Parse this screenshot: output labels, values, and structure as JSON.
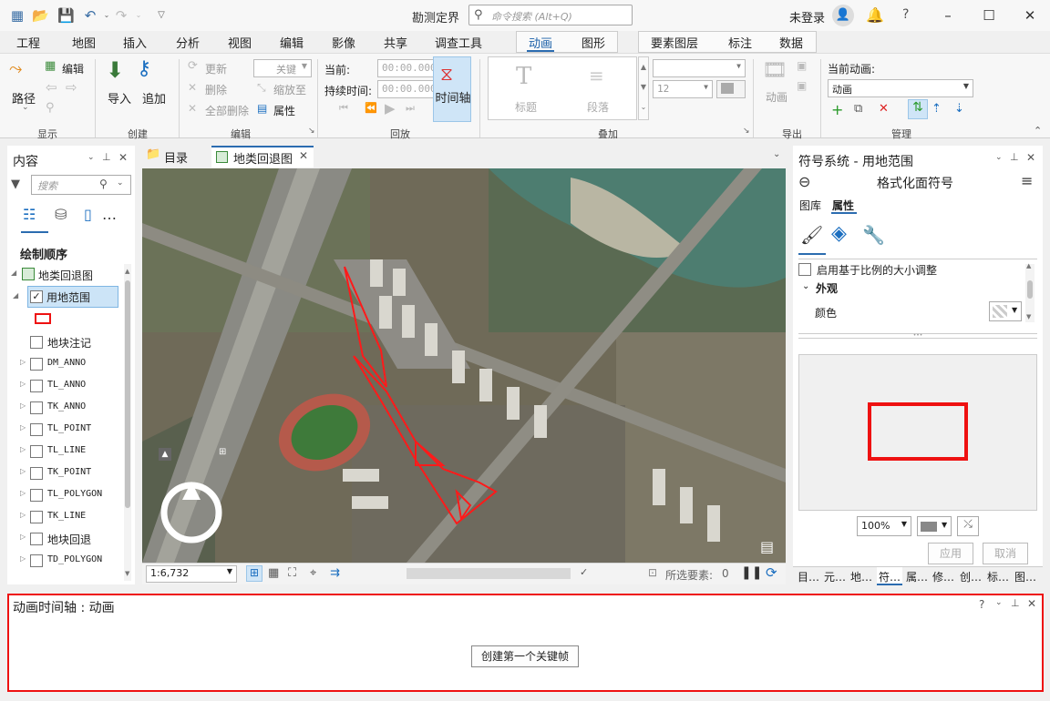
{
  "titlebar": {
    "title": "勘测定界",
    "search_placeholder": "命令搜索 (Alt+Q)",
    "login": "未登录"
  },
  "tabs": [
    "工程",
    "地图",
    "插入",
    "分析",
    "视图",
    "编辑",
    "影像",
    "共享",
    "调查工具",
    "动画",
    "图形",
    "要素图层",
    "标注",
    "数据"
  ],
  "ribbon": {
    "display": {
      "path": "路径",
      "edit": "编辑",
      "group": "显示"
    },
    "create": {
      "import": "导入",
      "add": "追加",
      "group": "创建"
    },
    "edit": {
      "update": "更新",
      "delete": "删除",
      "delete_all": "全部删除",
      "keyframe": "关键",
      "zoom_to": "缩放至",
      "properties": "属性",
      "group": "编辑"
    },
    "playback": {
      "current": "当前:",
      "duration": "持续时间:",
      "current_val": "00:00.000",
      "duration_val": "00:00.000",
      "timeline": "时间轴",
      "group": "回放"
    },
    "overlay": {
      "title": "标题",
      "paragraph": "段落",
      "font_size": "12",
      "group": "叠加"
    },
    "export": {
      "animation": "动画",
      "group": "导出"
    },
    "manage": {
      "current_anim_label": "当前动画:",
      "current_anim": "动画",
      "group": "管理"
    }
  },
  "contents": {
    "title": "内容",
    "search_placeholder": "搜索",
    "draw_order": "绘制顺序",
    "map_name": "地类回退图",
    "layers": [
      {
        "name": "用地范围",
        "checked": true
      },
      {
        "name": "地块注记",
        "checked": false
      },
      {
        "name": "DM_ANNO",
        "checked": false
      },
      {
        "name": "TL_ANNO",
        "checked": false
      },
      {
        "name": "TK_ANNO",
        "checked": false
      },
      {
        "name": "TL_POINT",
        "checked": false
      },
      {
        "name": "TL_LINE",
        "checked": false
      },
      {
        "name": "TK_POINT",
        "checked": false
      },
      {
        "name": "TL_POLYGON",
        "checked": false
      },
      {
        "name": "TK_LINE",
        "checked": false
      },
      {
        "name": "地块回退",
        "checked": false
      },
      {
        "name": "TD_POLYGON",
        "checked": false
      }
    ]
  },
  "view_tabs": {
    "catalog": "目录",
    "map": "地类回退图"
  },
  "statusbar": {
    "scale": "1:6,732",
    "selected": "所选要素:",
    "selected_count": "0"
  },
  "symbology": {
    "title": "符号系统 - 用地范围",
    "subtitle": "格式化面符号",
    "tab_gallery": "图库",
    "tab_properties": "属性",
    "scale_option": "启用基于比例的大小调整",
    "appearance": "外观",
    "color": "颜色",
    "zoom": "100%",
    "apply": "应用",
    "cancel": "取消",
    "bottom_tabs": [
      "目…",
      "元…",
      "地…",
      "符…",
      "属…",
      "修…",
      "创…",
      "标…",
      "图…"
    ]
  },
  "timeline": {
    "title": "动画时间轴 : 动画",
    "create_button": "创建第一个关键帧"
  },
  "colors": {
    "accent": "#2b6cb0",
    "highlight_red": "#ee1111",
    "selected_layer": "#cce4f7"
  }
}
